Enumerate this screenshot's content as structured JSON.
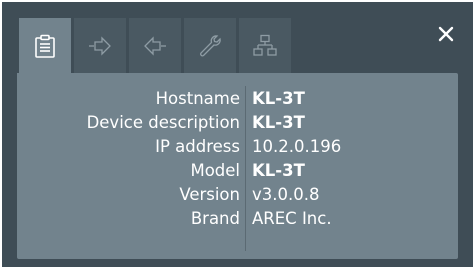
{
  "tabs": [
    {
      "icon": "clipboard-icon",
      "active": true
    },
    {
      "icon": "arrow-in-icon",
      "active": false
    },
    {
      "icon": "arrow-out-icon",
      "active": false
    },
    {
      "icon": "wrench-icon",
      "active": false
    },
    {
      "icon": "network-icon",
      "active": false
    }
  ],
  "close_icon": "close-icon",
  "info": {
    "hostname": {
      "label": "Hostname",
      "value": "KL-3T"
    },
    "description": {
      "label": "Device description",
      "value": "KL-3T"
    },
    "ip": {
      "label": "IP address",
      "value": "10.2.0.196"
    },
    "model": {
      "label": "Model",
      "value": "KL-3T"
    },
    "version": {
      "label": "Version",
      "value": "v3.0.0.8"
    },
    "brand": {
      "label": "Brand",
      "value": "AREC Inc."
    }
  },
  "colors": {
    "background": "#3f4d56",
    "panel": "#72838d",
    "tab_inactive": "#4a5962",
    "text": "#ffffff"
  }
}
